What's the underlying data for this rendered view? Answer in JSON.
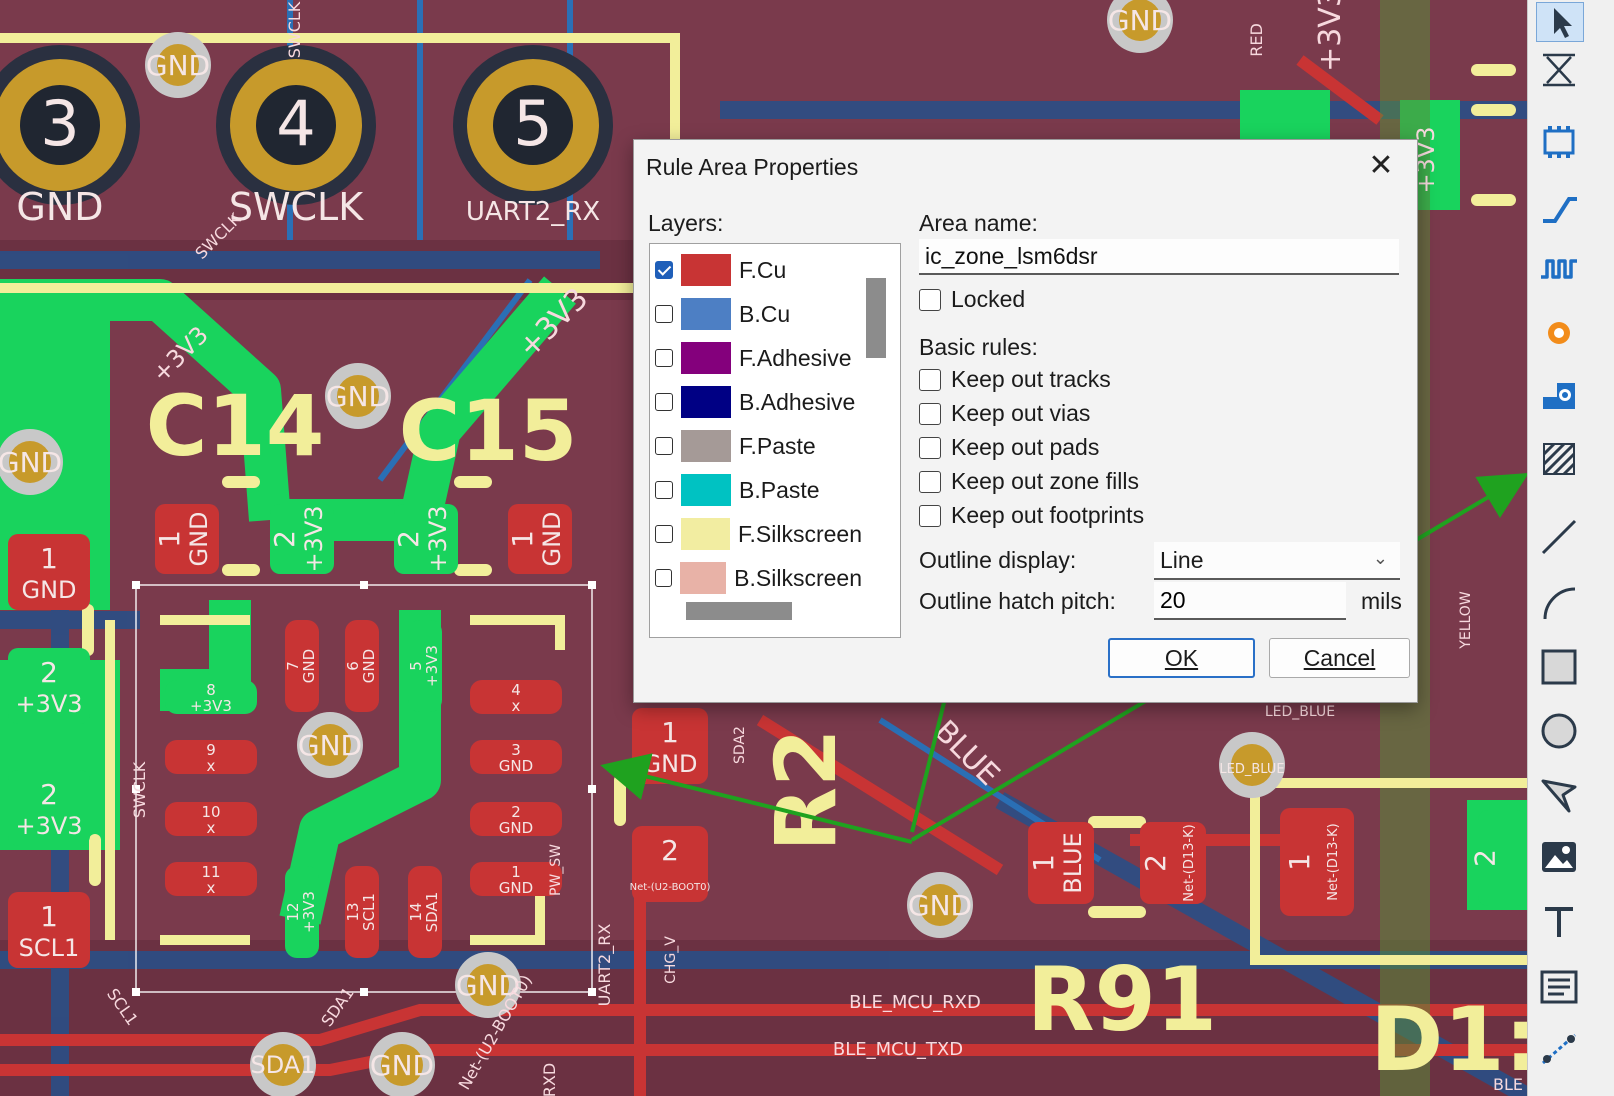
{
  "pcb": {
    "pads_top": [
      {
        "num": "3",
        "net": "GND"
      },
      {
        "num": "4",
        "net": "SWCLK"
      },
      {
        "num": "5",
        "net": "UART2_RX"
      }
    ],
    "refdes": [
      "C14",
      "C15",
      "R2",
      "R91",
      "D1:"
    ],
    "via_label": "GND",
    "via_labels_other": [
      "SDA1",
      "LED_BLUE"
    ],
    "smd_pads": [
      {
        "num": "1",
        "net": "GND"
      },
      {
        "num": "2",
        "net": "+3V3"
      },
      {
        "num": "2",
        "net": "+3V3"
      },
      {
        "num": "1",
        "net": "GND"
      },
      {
        "num": "1",
        "net": "GND"
      },
      {
        "num": "2",
        "net": "+3V3"
      },
      {
        "num": "2",
        "net": "+3V3"
      },
      {
        "num": "1",
        "net": "SCL1"
      },
      {
        "num": "1",
        "net": "GND"
      },
      {
        "num": "2",
        "net": "Net-(U2-BOOT0)"
      },
      {
        "num": "1",
        "net": "BLUE"
      },
      {
        "num": "2",
        "net": "Net-(D13-K)"
      },
      {
        "num": "1",
        "net": "Net-(D13-K)"
      },
      {
        "num": "2",
        "net": ""
      }
    ],
    "ic_pads": [
      {
        "num": "8",
        "net": "+3V3"
      },
      {
        "num": "9",
        "net": "x"
      },
      {
        "num": "10",
        "net": "x"
      },
      {
        "num": "11",
        "net": "x"
      },
      {
        "num": "7",
        "net": "GND"
      },
      {
        "num": "6",
        "net": "GND"
      },
      {
        "num": "5",
        "net": "+3V3"
      },
      {
        "num": "4",
        "net": "x"
      },
      {
        "num": "3",
        "net": "GND"
      },
      {
        "num": "2",
        "net": "GND"
      },
      {
        "num": "1",
        "net": "GND"
      },
      {
        "num": "12",
        "net": "+3V3"
      },
      {
        "num": "13",
        "net": "SCL1"
      },
      {
        "num": "14",
        "net": "SDA1"
      }
    ],
    "net_labels": [
      "SWCLK",
      "SWCLK",
      "SWCLK",
      "RED",
      "+3V3",
      "+3V3",
      "+3V3",
      "+3V3",
      "BLUE",
      "LED_BLUE",
      "SDA2",
      "BLE_MCU_RXD",
      "BLE_MCU_TXD",
      "SCL1",
      "SDA1",
      "RXD",
      "UART2_RX",
      "CHG_V",
      "PW_SW",
      "YELLOW",
      "BLE",
      "Net-(U2-BOOT0)"
    ]
  },
  "dialog": {
    "title": "Rule Area Properties",
    "close_glyph": "✕",
    "layers_label": "Layers:",
    "layers": [
      {
        "name": "F.Cu",
        "color": "#c83434",
        "checked": true
      },
      {
        "name": "B.Cu",
        "color": "#4d7fc4",
        "checked": false
      },
      {
        "name": "F.Adhesive",
        "color": "#84007c",
        "checked": false
      },
      {
        "name": "B.Adhesive",
        "color": "#000084",
        "checked": false
      },
      {
        "name": "F.Paste",
        "color": "#a59a97",
        "checked": false
      },
      {
        "name": "B.Paste",
        "color": "#00c2c2",
        "checked": false
      },
      {
        "name": "F.Silkscreen",
        "color": "#f2eda1",
        "checked": false
      },
      {
        "name": "B.Silkscreen",
        "color": "#e8b2a7",
        "checked": false
      }
    ],
    "area_name_label": "Area name:",
    "area_name_value": "ic_zone_lsm6dsr",
    "locked_label": "Locked",
    "basic_rules_label": "Basic rules:",
    "rules": [
      "Keep out tracks",
      "Keep out vias",
      "Keep out pads",
      "Keep out zone fills",
      "Keep out footprints"
    ],
    "outline_display_label": "Outline display:",
    "outline_display_value": "Line",
    "hatch_pitch_label": "Outline hatch pitch:",
    "hatch_pitch_value": "20",
    "hatch_pitch_units": "mils",
    "ok_label": "OK",
    "cancel_label": "Cancel"
  },
  "toolbar": {
    "tools": [
      "select-icon",
      "local-ratsnest-icon",
      "add-footprint-icon",
      "route-track-icon",
      "tune-length-icon",
      "add-via-icon",
      "add-zone-icon",
      "add-rule-area-icon",
      "draw-line-icon",
      "draw-arc-icon",
      "draw-rectangle-icon",
      "draw-circle-icon",
      "draw-polygon-icon",
      "add-image-icon",
      "add-text-icon",
      "add-textbox-icon",
      "add-dimension-icon"
    ]
  },
  "colors": {
    "board_fill": "#7a3a4c",
    "copper_red": "#c83434",
    "copper_green": "#19d35d",
    "back_copper": "#2a6fb5",
    "silkscreen": "#f2ee9a",
    "arrow": "#1fa21f"
  }
}
